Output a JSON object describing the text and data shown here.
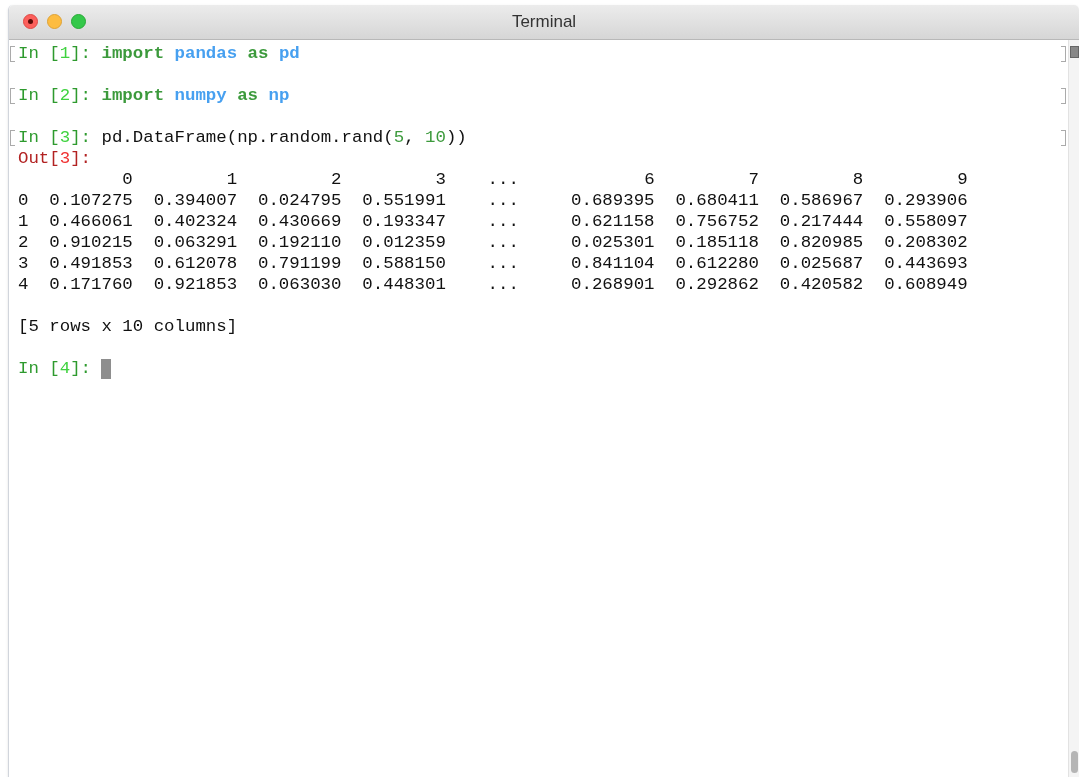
{
  "window": {
    "title": "Terminal"
  },
  "cells": [
    {
      "kind": "input",
      "marked": true,
      "prompt": [
        {
          "kind": "label",
          "text": "In ["
        },
        {
          "kind": "number",
          "text": "1"
        },
        {
          "kind": "label",
          "text": "]:"
        }
      ],
      "tokens": [
        {
          "kind": "keyword",
          "text": "import "
        },
        {
          "kind": "name",
          "text": "pandas "
        },
        {
          "kind": "keyword",
          "text": "as "
        },
        {
          "kind": "name",
          "text": "pd"
        }
      ]
    },
    {
      "kind": "input",
      "marked": true,
      "prompt": [
        {
          "kind": "label",
          "text": "In ["
        },
        {
          "kind": "number",
          "text": "2"
        },
        {
          "kind": "label",
          "text": "]:"
        }
      ],
      "tokens": [
        {
          "kind": "keyword",
          "text": "import "
        },
        {
          "kind": "name",
          "text": "numpy "
        },
        {
          "kind": "keyword",
          "text": "as "
        },
        {
          "kind": "name",
          "text": "np"
        }
      ]
    },
    {
      "kind": "input",
      "marked": true,
      "prompt": [
        {
          "kind": "label",
          "text": "In ["
        },
        {
          "kind": "number",
          "text": "3"
        },
        {
          "kind": "label",
          "text": "]:"
        }
      ],
      "tokens": [
        {
          "kind": "plain",
          "text": "pd.DataFrame(np.random.rand("
        },
        {
          "kind": "number",
          "text": "5"
        },
        {
          "kind": "plain",
          "text": ", "
        },
        {
          "kind": "number",
          "text": "10"
        },
        {
          "kind": "plain",
          "text": "))"
        }
      ]
    },
    {
      "kind": "output",
      "marked": false,
      "prompt": [
        {
          "kind": "label",
          "text": "Out["
        },
        {
          "kind": "number",
          "text": "3"
        },
        {
          "kind": "label",
          "text": "]:"
        }
      ],
      "table": {
        "columns": [
          "0",
          "1",
          "2",
          "3",
          "...",
          "6",
          "7",
          "8",
          "9"
        ],
        "rows": [
          {
            "index": "0",
            "values": [
              "0.107275",
              "0.394007",
              "0.024795",
              "0.551991",
              "...",
              "0.689395",
              "0.680411",
              "0.586967",
              "0.293906"
            ]
          },
          {
            "index": "1",
            "values": [
              "0.466061",
              "0.402324",
              "0.430669",
              "0.193347",
              "...",
              "0.621158",
              "0.756752",
              "0.217444",
              "0.558097"
            ]
          },
          {
            "index": "2",
            "values": [
              "0.910215",
              "0.063291",
              "0.192110",
              "0.012359",
              "...",
              "0.025301",
              "0.185118",
              "0.820985",
              "0.208302"
            ]
          },
          {
            "index": "3",
            "values": [
              "0.491853",
              "0.612078",
              "0.791199",
              "0.588150",
              "...",
              "0.841104",
              "0.612280",
              "0.025687",
              "0.443693"
            ]
          },
          {
            "index": "4",
            "values": [
              "0.171760",
              "0.921853",
              "0.063030",
              "0.448301",
              "...",
              "0.268901",
              "0.292862",
              "0.420582",
              "0.608949"
            ]
          }
        ]
      },
      "summary": "[5 rows x 10 columns]"
    },
    {
      "kind": "input",
      "marked": false,
      "cursor": true,
      "prompt": [
        {
          "kind": "label",
          "text": "In ["
        },
        {
          "kind": "number",
          "text": "4"
        },
        {
          "kind": "label",
          "text": "]:"
        }
      ]
    }
  ]
}
